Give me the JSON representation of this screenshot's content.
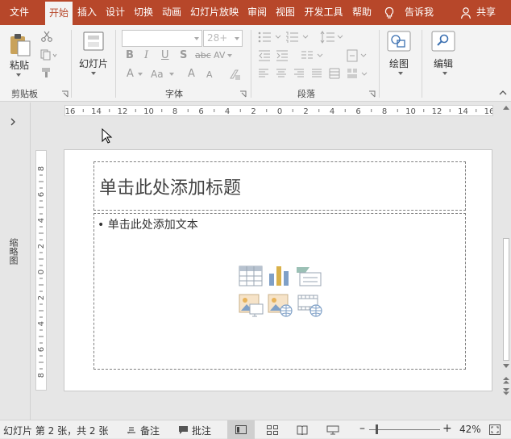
{
  "tabs": [
    {
      "label": "文件",
      "active": false
    },
    {
      "label": "开始",
      "active": true
    },
    {
      "label": "插入",
      "active": false
    },
    {
      "label": "设计",
      "active": false
    },
    {
      "label": "切换",
      "active": false
    },
    {
      "label": "动画",
      "active": false
    },
    {
      "label": "幻灯片放映",
      "active": false
    },
    {
      "label": "审阅",
      "active": false
    },
    {
      "label": "视图",
      "active": false
    },
    {
      "label": "开发工具",
      "active": false
    },
    {
      "label": "帮助",
      "active": false
    },
    {
      "label": "告诉我",
      "active": false
    },
    {
      "label": "共享",
      "active": false
    }
  ],
  "ribbon": {
    "clipboard": {
      "paste_label": "粘贴",
      "group_label": "剪贴板"
    },
    "slides": {
      "new_slide_label": "幻灯片"
    },
    "font": {
      "font_size": "28+",
      "group_label": "字体",
      "bold": "B",
      "italic": "I",
      "underline": "U",
      "shadow": "S",
      "strike": "abc",
      "spacing": "AV",
      "grow": "A",
      "shrink": "A",
      "case": "Aa",
      "color": "A",
      "highlight": "A"
    },
    "paragraph": {
      "group_label": "段落"
    },
    "drawing": {
      "label": "绘图"
    },
    "editing": {
      "label": "编辑"
    }
  },
  "thumbnail_pane": {
    "label": "缩略图"
  },
  "hruler_labels": [
    "16",
    "14",
    "12",
    "10",
    "8",
    "6",
    "4",
    "2",
    "0",
    "2",
    "4",
    "6",
    "8",
    "10",
    "12",
    "14",
    "16"
  ],
  "vruler_labels": [
    "8",
    "6",
    "4",
    "2",
    "0",
    "2",
    "4",
    "6",
    "8"
  ],
  "slide": {
    "title_placeholder": "单击此处添加标题",
    "body_placeholder": "单击此处添加文本"
  },
  "status": {
    "slide_info": "幻灯片 第 2 张，共 2 张",
    "notes": "备注",
    "comments": "批注",
    "zoom": "42%"
  },
  "colors": {
    "accent": "#b7472a",
    "ribbon_bg": "#f3f3f3",
    "workspace": "#e6e6e6"
  }
}
